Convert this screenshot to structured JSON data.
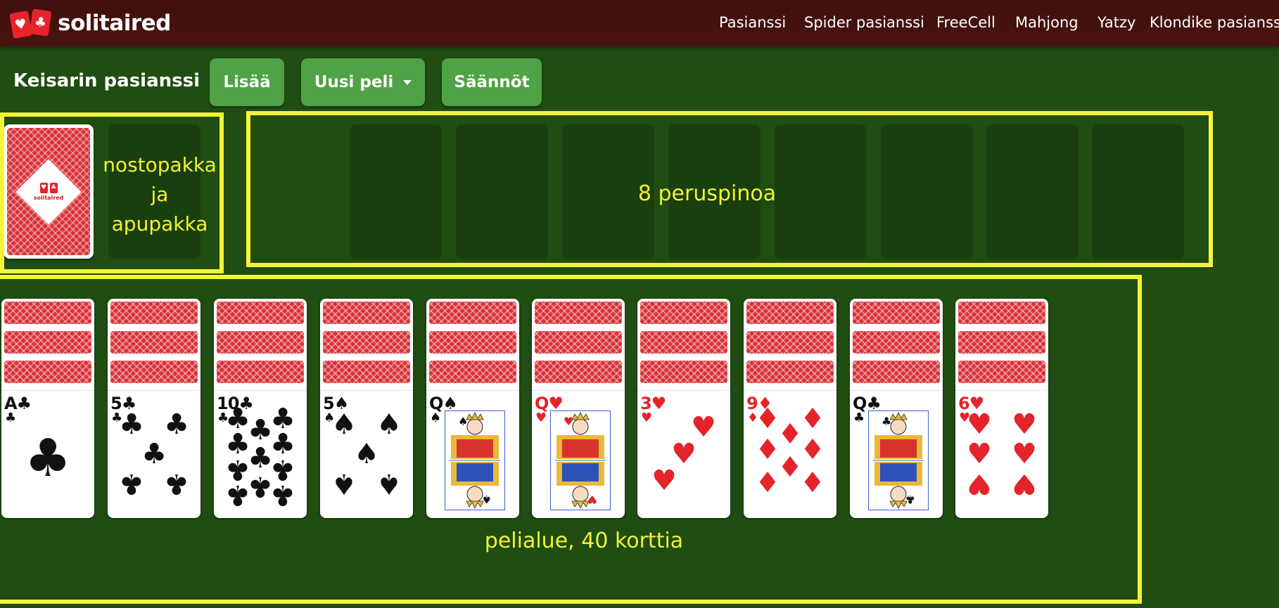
{
  "header": {
    "logo_text": "solitaired",
    "nav": [
      "Pasianssi",
      "Spider pasianssi",
      "FreeCell",
      "Mahjong",
      "Yatzy",
      "Klondike pasianssi"
    ]
  },
  "toolbar": {
    "title": "Keisarin pasianssi",
    "more_label": "Lisää",
    "new_game_label": "Uusi peli",
    "rules_label": "Säännöt"
  },
  "annotations": {
    "stock_line1": "nostopakka",
    "stock_line2": "ja",
    "stock_line3": "apupakka",
    "foundations": "8 peruspinoa",
    "tableau": "pelialue, 40 korttia"
  },
  "stock_logo": "solitaired",
  "colors": {
    "felt": "#1f4d12",
    "header": "#441210",
    "button": "#4fa245",
    "highlight": "#f4f43a",
    "card_back": "#d92f36"
  },
  "tableau": [
    {
      "rank": "A",
      "suit": "♣",
      "color": "black",
      "face_down": 3
    },
    {
      "rank": "5",
      "suit": "♣",
      "color": "black",
      "face_down": 3
    },
    {
      "rank": "10",
      "suit": "♣",
      "color": "black",
      "face_down": 3
    },
    {
      "rank": "5",
      "suit": "♠",
      "color": "black",
      "face_down": 3
    },
    {
      "rank": "Q",
      "suit": "♠",
      "color": "black",
      "face_down": 3
    },
    {
      "rank": "Q",
      "suit": "♥",
      "color": "red",
      "face_down": 3
    },
    {
      "rank": "3",
      "suit": "♥",
      "color": "red",
      "face_down": 3
    },
    {
      "rank": "9",
      "suit": "♦",
      "color": "red",
      "face_down": 3
    },
    {
      "rank": "Q",
      "suit": "♣",
      "color": "black",
      "face_down": 3
    },
    {
      "rank": "6",
      "suit": "♥",
      "color": "red",
      "face_down": 3
    }
  ]
}
